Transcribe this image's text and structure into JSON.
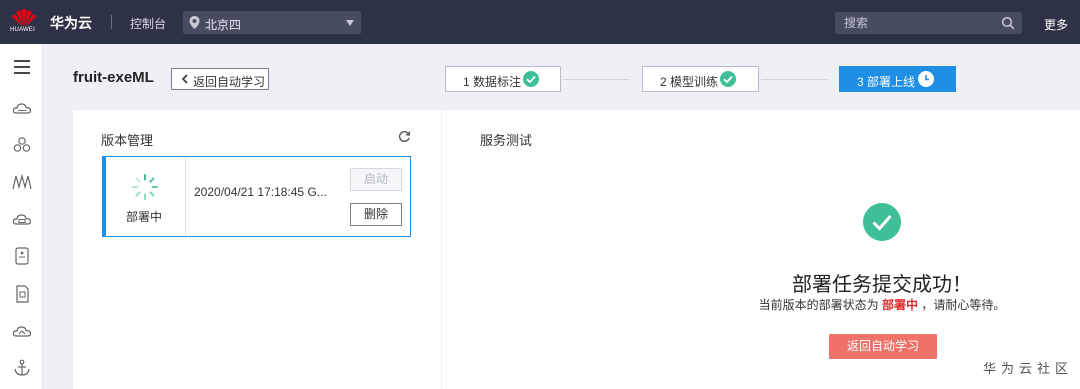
{
  "topbar": {
    "brand": "华为云",
    "logo_text": "HUAWEI",
    "console": "控制台",
    "region": "北京四",
    "search_placeholder": "搜索",
    "more": "更多"
  },
  "header": {
    "title": "fruit-exeML",
    "back_label": "返回自动学习"
  },
  "steps": [
    {
      "label": "1 数据标注",
      "state": "done"
    },
    {
      "label": "2 模型训练",
      "state": "done"
    },
    {
      "label": "3 部署上线",
      "state": "active"
    }
  ],
  "version_panel": {
    "title": "版本管理",
    "versions": [
      {
        "status": "部署中",
        "time": "2020/04/21 17:18:45 G...",
        "start_label": "启动",
        "delete_label": "删除"
      }
    ]
  },
  "service_panel": {
    "title": "服务测试",
    "success_title": "部署任务提交成功！",
    "sub_prefix": "当前版本的部署状态为",
    "sub_status": "部署中",
    "sub_suffix": "，请耐心等待。",
    "back_button": "返回自动学习"
  },
  "watermark": "华为云社区",
  "colors": {
    "topbar": "#2e3246",
    "accent_blue": "#1f8ee6",
    "success_green": "#3fbf97",
    "danger_red": "#e02b2b",
    "button_red": "#f0706a"
  }
}
